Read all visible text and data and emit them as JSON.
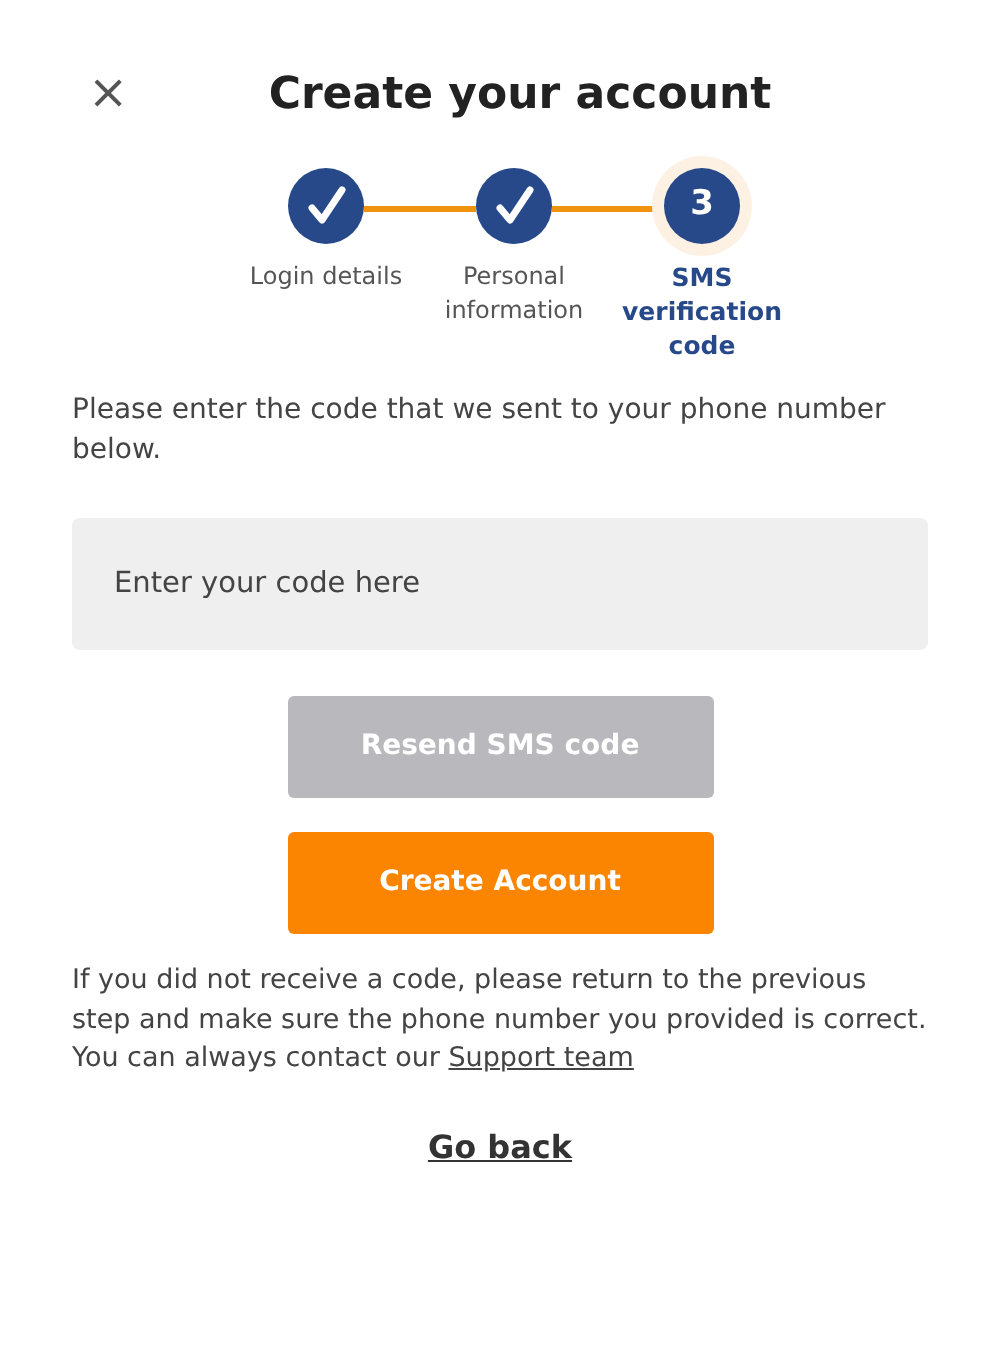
{
  "close_label": "×",
  "title": "Create your account",
  "steps": [
    {
      "label": "Login details",
      "completed": true,
      "selected": false
    },
    {
      "label": "Personal information",
      "completed": true,
      "selected": false
    },
    {
      "label": "SMS verification code",
      "completed": false,
      "selected": true,
      "number": "3"
    }
  ],
  "instruction": "Please enter the code that we sent to your phone number below.",
  "code_field": {
    "placeholder": "Enter your code here"
  },
  "buttons": [
    {
      "label": "Resend SMS code",
      "kind": "secondary",
      "disabled": true
    },
    {
      "label": "Create Account",
      "kind": "primary",
      "disabled": false
    }
  ],
  "help_text": "If you did not receive a code, please return to the previous step and make sure the phone number you provided is correct. You can always contact our",
  "help_link": "Support team",
  "back_link": "Go back"
}
